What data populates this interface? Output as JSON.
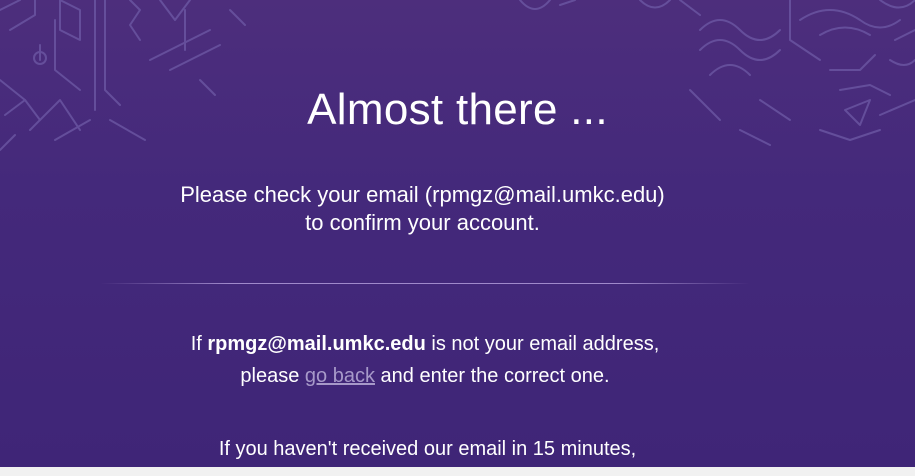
{
  "heading": "Almost there ...",
  "check_email": {
    "line1": "Please check your email (rpmgz@mail.umkc.edu)",
    "line2": "to confirm your account."
  },
  "wrong_email": {
    "prefix": "If ",
    "email": "rpmgz@mail.umkc.edu",
    "suffix": " is not your email address,",
    "line2_prefix": "please ",
    "link_text": "go back",
    "line2_suffix": " and enter the correct one."
  },
  "not_received": {
    "line1": "If you haven't received our email in 15 minutes,"
  },
  "colors": {
    "background": "#44297b",
    "link": "#a799c9",
    "text": "#ffffff"
  }
}
